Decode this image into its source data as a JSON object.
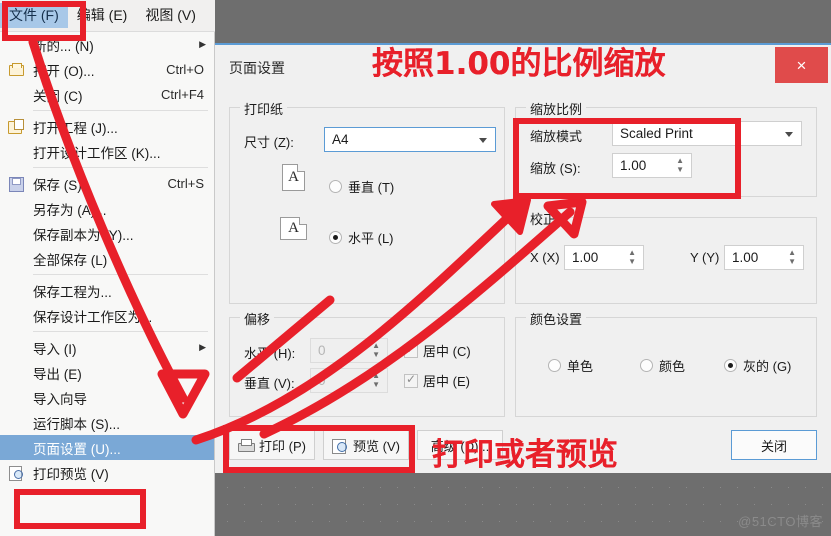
{
  "app": {
    "background_color": "#6e6e6e",
    "accent_color": "#5b9bd5",
    "annotation_color": "#e8202a"
  },
  "menubar": {
    "items": [
      {
        "label": "文件 (F)",
        "active": true
      },
      {
        "label": "编辑 (E)",
        "active": false
      },
      {
        "label": "视图 (V)",
        "active": false
      }
    ]
  },
  "file_menu": {
    "items": [
      {
        "label": "新的... (N)",
        "accel": "",
        "icon": "",
        "submenu": true,
        "sep_after": false,
        "selected": false
      },
      {
        "label": "打开 (O)...",
        "accel": "Ctrl+O",
        "icon": "folder-open-icon",
        "submenu": false,
        "sep_after": false,
        "selected": false
      },
      {
        "label": "关闭 (C)",
        "accel": "Ctrl+F4",
        "icon": "",
        "submenu": false,
        "sep_after": true,
        "selected": false
      },
      {
        "label": "打开工程 (J)...",
        "accel": "",
        "icon": "folder-page-icon",
        "submenu": false,
        "sep_after": false,
        "selected": false
      },
      {
        "label": "打开设计工作区 (K)...",
        "accel": "",
        "icon": "",
        "submenu": false,
        "sep_after": true,
        "selected": false
      },
      {
        "label": "保存 (S)",
        "accel": "Ctrl+S",
        "icon": "save-icon",
        "submenu": false,
        "sep_after": false,
        "selected": false
      },
      {
        "label": "另存为 (A)...",
        "accel": "",
        "icon": "",
        "submenu": false,
        "sep_after": false,
        "selected": false
      },
      {
        "label": "保存副本为 (Y)...",
        "accel": "",
        "icon": "",
        "submenu": false,
        "sep_after": false,
        "selected": false
      },
      {
        "label": "全部保存 (L)",
        "accel": "",
        "icon": "",
        "submenu": false,
        "sep_after": true,
        "selected": false
      },
      {
        "label": "保存工程为...",
        "accel": "",
        "icon": "",
        "submenu": false,
        "sep_after": false,
        "selected": false
      },
      {
        "label": "保存设计工作区为...",
        "accel": "",
        "icon": "",
        "submenu": false,
        "sep_after": true,
        "selected": false
      },
      {
        "label": "导入 (I)",
        "accel": "",
        "icon": "",
        "submenu": true,
        "sep_after": false,
        "selected": false
      },
      {
        "label": "导出 (E)",
        "accel": "",
        "icon": "",
        "submenu": false,
        "sep_after": false,
        "selected": false
      },
      {
        "label": "导入向导",
        "accel": "",
        "icon": "",
        "submenu": false,
        "sep_after": false,
        "selected": false
      },
      {
        "label": "运行脚本 (S)...",
        "accel": "",
        "icon": "",
        "submenu": false,
        "sep_after": false,
        "selected": false
      },
      {
        "label": "页面设置 (U)...",
        "accel": "",
        "icon": "",
        "submenu": false,
        "sep_after": false,
        "selected": true
      },
      {
        "label": "打印预览 (V)",
        "accel": "",
        "icon": "preview-icon",
        "submenu": false,
        "sep_after": false,
        "selected": false
      }
    ]
  },
  "dialog": {
    "title": "页面设置",
    "close_label": "×",
    "paper_group": {
      "legend": "打印纸",
      "size_label": "尺寸 (Z):",
      "size_value": "A4",
      "portrait_label": "垂直 (T)",
      "portrait_selected": false,
      "landscape_label": "水平 (L)",
      "landscape_selected": true,
      "page_glyph": "A"
    },
    "offset_group": {
      "legend": "偏移",
      "horizontal_label": "水平 (H):",
      "horizontal_value": "0",
      "horizontal_center_label": "居中 (C)",
      "horizontal_center_checked": true,
      "vertical_label": "垂直 (V):",
      "vertical_value": "0",
      "vertical_center_label": "居中 (E)",
      "vertical_center_checked": true
    },
    "scale_group": {
      "legend": "缩放比例",
      "mode_label": "缩放模式",
      "mode_value": "Scaled Print",
      "scale_label": "缩放 (S):",
      "scale_value": "1.00"
    },
    "correction_group": {
      "legend": "校正",
      "x_label": "X (X)",
      "x_value": "1.00",
      "y_label": "Y (Y)",
      "y_value": "1.00"
    },
    "color_group": {
      "legend": "颜色设置",
      "options": [
        {
          "label": "单色",
          "selected": false
        },
        {
          "label": "颜色",
          "selected": false
        },
        {
          "label": "灰的 (G)",
          "selected": true
        }
      ]
    },
    "buttons": {
      "print": "打印 (P)",
      "preview": "预览 (V)",
      "advanced": "高级 (D)...",
      "close": "关闭"
    }
  },
  "annotations": {
    "scale_note": "按照1.00的比例缩放",
    "print_note": "打印或者预览"
  },
  "watermark": "@51CTO博客"
}
